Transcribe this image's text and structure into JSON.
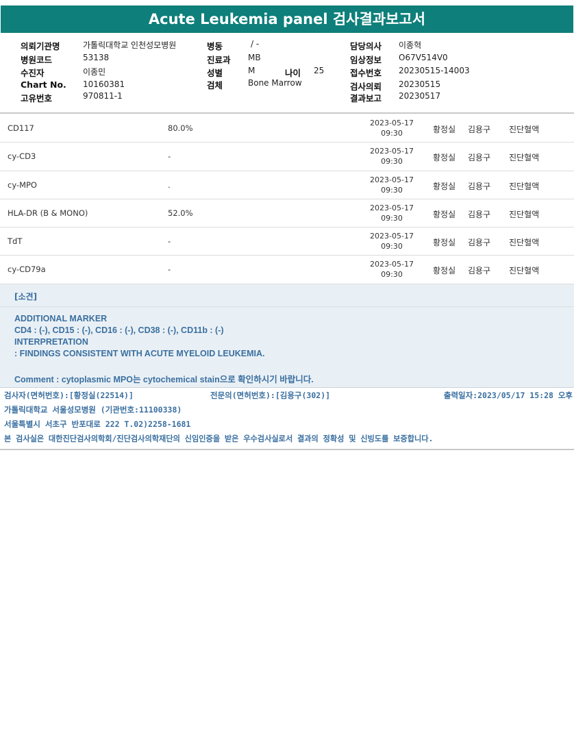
{
  "title": "Acute Leukemia panel 검사결과보고서",
  "info": {
    "hospital_label": "의뢰기관명",
    "hospital": "가톨릭대학교 인천성모병원",
    "code_label": "병원코드",
    "code": "53138",
    "patient_label": "수진자",
    "patient": "이종민",
    "chart_label": "Chart No.",
    "chart": "10160381",
    "unique_label": "고유번호",
    "unique": "970811-1",
    "ward_label": "병동",
    "ward": "/ -",
    "dept_label": "진료과",
    "dept": "MB",
    "sex_label": "성별",
    "sex": "M",
    "age_label": "나이",
    "age": "25",
    "specimen_label": "검체",
    "specimen": "Bone Marrow",
    "doctor_label": "담당의사",
    "doctor": "이종혁",
    "clinical_label": "임상정보",
    "clinical": "O67V514V0",
    "receipt_label": "접수번호",
    "receipt": "20230515-14003",
    "request_label": "검사의뢰",
    "request": "20230515",
    "report_label": "결과보고",
    "report": "20230517"
  },
  "results": [
    {
      "name": "CD117",
      "result": "80.0%",
      "date": "2023-05-17",
      "time": "09:30",
      "tester": "황정실",
      "doctor": "김용구",
      "dept": "진단혈액"
    },
    {
      "name": "cy-CD3",
      "result": "-",
      "date": "2023-05-17",
      "time": "09:30",
      "tester": "황정실",
      "doctor": "김용구",
      "dept": "진단혈액"
    },
    {
      "name": "cy-MPO",
      "result": ".",
      "date": "2023-05-17",
      "time": "09:30",
      "tester": "황정실",
      "doctor": "김용구",
      "dept": "진단혈액"
    },
    {
      "name": "HLA-DR (B & MONO)",
      "result": "52.0%",
      "date": "2023-05-17",
      "time": "09:30",
      "tester": "황정실",
      "doctor": "김용구",
      "dept": "진단혈액"
    },
    {
      "name": "TdT",
      "result": "-",
      "date": "2023-05-17",
      "time": "09:30",
      "tester": "황정실",
      "doctor": "김용구",
      "dept": "진단혈액"
    },
    {
      "name": "cy-CD79a",
      "result": "-",
      "date": "2023-05-17",
      "time": "09:30",
      "tester": "황정실",
      "doctor": "김용구",
      "dept": "진단혈액"
    }
  ],
  "remarks": {
    "header": "[소견]",
    "line1": "ADDITIONAL MARKER",
    "line2": "CD4 : (-), CD15 : (-), CD16 : (-), CD38 : (-), CD11b : (-)",
    "line3": "INTERPRETATION",
    "line4": " : FINDINGS CONSISTENT WITH ACUTE MYELOID LEUKEMIA.",
    "line5": "Comment : cytoplasmic MPO는 cytochemical stain으로 확인하시기 바랍니다."
  },
  "footer": {
    "tester": "검사자(면허번호):[황정실(22514)]",
    "specialist": "전문의(면허번호):[김용구(302)]",
    "printed": "출력일자:2023/05/17 15:28 오후",
    "lab": "가톨릭대학교 서울성모병원 (기관번호:11100338)",
    "address": "서울특별시 서초구 반포대로 222 T.02)2258-1681",
    "cert": "본 검사실은 대한진단검사의학회/진단검사의학재단의 신임인증을 받은 우수검사실로서 결과의 정확성 및 신빙도를 보증합니다."
  }
}
